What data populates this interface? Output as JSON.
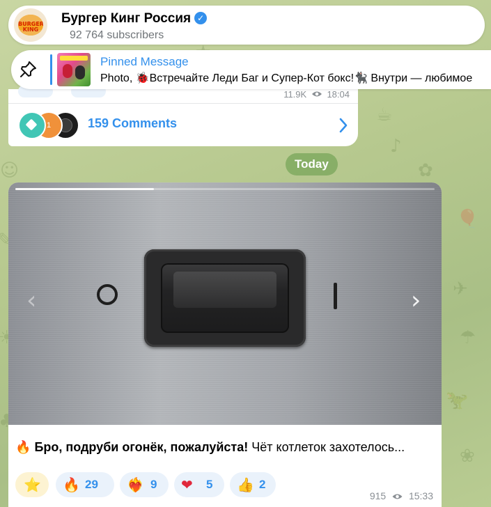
{
  "channel": {
    "name": "Бургер Кинг Россия",
    "subscribers": "92 764 subscribers",
    "avatar_line1": "BURGER",
    "avatar_line2": "KING",
    "verified_icon": "verified-check-icon"
  },
  "pinned": {
    "title": "Pinned Message",
    "text": "Photo, 🐞Встречайте Леди Баг и Супер-Кот бокс!🐈‍⬛ Внутри — любимое",
    "thumb_label": "ВЫМЕТАЙ"
  },
  "previous_post": {
    "views": "11.9K",
    "time": "18:04",
    "comments_label": "159 Comments",
    "commenter_badge": "1"
  },
  "date_chip": "Today",
  "post": {
    "media_progress": 0.33,
    "caption_bold": "Бро, подруби огонёк, пожалуйста!",
    "caption_rest": " Чёт котлеток захотелось...",
    "caption_emoji": "🔥",
    "reactions": [
      {
        "emoji": "⭐",
        "count": ""
      },
      {
        "emoji": "🔥",
        "count": "29"
      },
      {
        "emoji": "❤‍🔥",
        "count": "9"
      },
      {
        "emoji": "❤",
        "count": "5"
      },
      {
        "emoji": "👍",
        "count": "2"
      }
    ],
    "views": "915",
    "time": "15:33"
  },
  "colors": {
    "accent": "#3390ec",
    "bubble": "#ffffff",
    "chat_bg": "#b7c98f",
    "muted_text": "#8a8f94"
  }
}
